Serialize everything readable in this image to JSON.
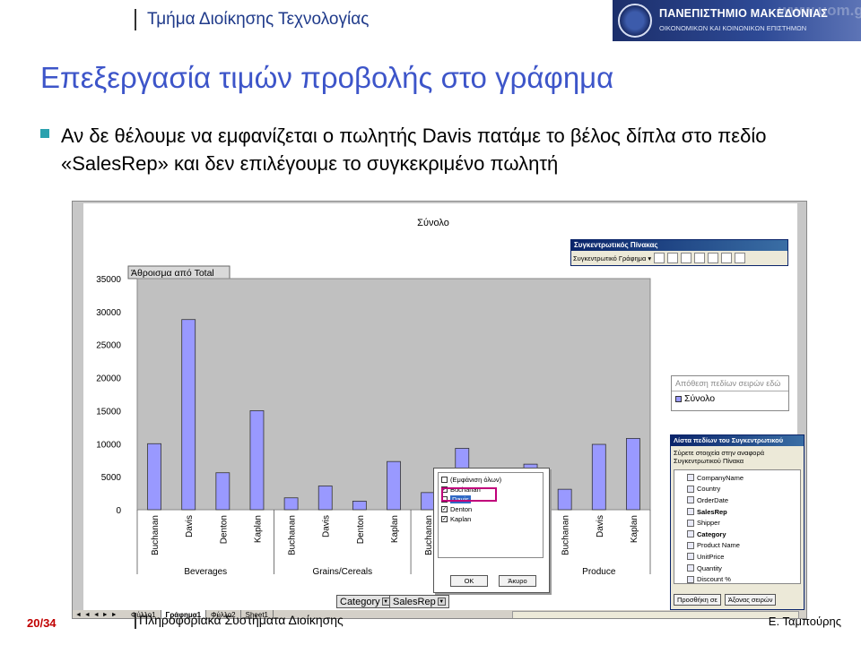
{
  "header": {
    "department": "Τμήμα Διοίκησης Τεχνολογίας",
    "logo_line1": "ΠΑΝΕΠΙΣΤΗΜΙΟ ΜΑΚΕΔΟΝΙΑΣ",
    "logo_line2": "ΟΙΚΟΝΟΜΙΚΩΝ ΚΑΙ ΚΟΙΝΩΝΙΚΩΝ ΕΠΙΣΤΗΜΩΝ",
    "logo_url": "www.uom.gr"
  },
  "slide": {
    "title": "Επεξεργασία τιμών προβολής στο γράφημα",
    "bullet": "Αν δε θέλουμε να εμφανίζεται ο πωλητής Davis πατάμε το βέλος δίπλα στο πεδίο «SalesRep» και δεν επιλέγουμε το συγκεκριμένο πωλητή"
  },
  "colors": {
    "title": "#3d55c9",
    "bullet_mark": "#2aa1ae",
    "bar_fill": "#9999ff",
    "plot_bg": "#c0c0c0",
    "page_number": "#c00000"
  },
  "chart_data": {
    "type": "bar",
    "title": "Σύνολο",
    "data_field": "Άθροισμα από Total",
    "ylim": [
      0,
      35000
    ],
    "yticks": [
      0,
      5000,
      10000,
      15000,
      20000,
      25000,
      30000,
      35000
    ],
    "categories": [
      "Buchanan",
      "Davis",
      "Denton",
      "Kaplan",
      "Buchanan",
      "Davis",
      "Denton",
      "Kaplan",
      "Buchanan",
      "Davis",
      "Denton",
      "Kaplan",
      "Buchanan",
      "Davis",
      "Kaplan"
    ],
    "groups": [
      {
        "name": "Beverages",
        "span": 4
      },
      {
        "name": "Grains/Cereals",
        "span": 4
      },
      {
        "name": "",
        "span": 4
      },
      {
        "name": "Produce",
        "span": 3
      }
    ],
    "series": [
      {
        "name": "Σύνολο",
        "values": [
          10000,
          28800,
          5600,
          15000,
          1800,
          3600,
          1300,
          7300,
          2600,
          9300,
          4500,
          6900,
          3100,
          9900,
          10800
        ]
      }
    ],
    "grid": false,
    "legend": "right"
  },
  "pivot_toolbar": {
    "title": "Συγκεντρωτικός Πίνακας",
    "menu": "Συγκεντρωτικό Γράφημα ▾"
  },
  "series_box": {
    "drop_hint": "Απόθεση πεδίων σειρών εδώ",
    "item": "Σύνολο"
  },
  "field_list": {
    "title": "Λίστα πεδίων του Συγκεντρωτικού",
    "instructions": "Σύρετε στοιχεία στην αναφορά Συγκεντρωτικού Πίνακα",
    "fields": [
      {
        "label": "CompanyName",
        "bold": false
      },
      {
        "label": "Country",
        "bold": false
      },
      {
        "label": "OrderDate",
        "bold": false
      },
      {
        "label": "SalesRep",
        "bold": true
      },
      {
        "label": "Shipper",
        "bold": false
      },
      {
        "label": "Category",
        "bold": true
      },
      {
        "label": "Product Name",
        "bold": false
      },
      {
        "label": "UnitPrice",
        "bold": false
      },
      {
        "label": "Quantity",
        "bold": false
      },
      {
        "label": "Discount %",
        "bold": false
      }
    ],
    "add_button": "Προσθήκη σε",
    "target": "Άξονας σειρών"
  },
  "filter_popup": {
    "options": [
      {
        "label": "(Εμφάνιση όλων)",
        "checked": false,
        "selected": false
      },
      {
        "label": "Buchanan",
        "checked": true,
        "selected": false
      },
      {
        "label": "Davis",
        "checked": false,
        "selected": true
      },
      {
        "label": "Denton",
        "checked": true,
        "selected": false
      },
      {
        "label": "Kaplan",
        "checked": true,
        "selected": false
      }
    ],
    "ok": "OK",
    "cancel": "Άκυρο"
  },
  "page_fields": {
    "category": "Category",
    "salesrep": "SalesRep"
  },
  "sheet_tabs": [
    "Φύλλο1",
    "Γράφημα1",
    "Φύλλο2",
    "Sheet1"
  ],
  "footer": {
    "page": "20/34",
    "course": "Πληροφοριακά Συστήματα Διοίκησης",
    "author": "Ε. Ταμπούρης"
  }
}
